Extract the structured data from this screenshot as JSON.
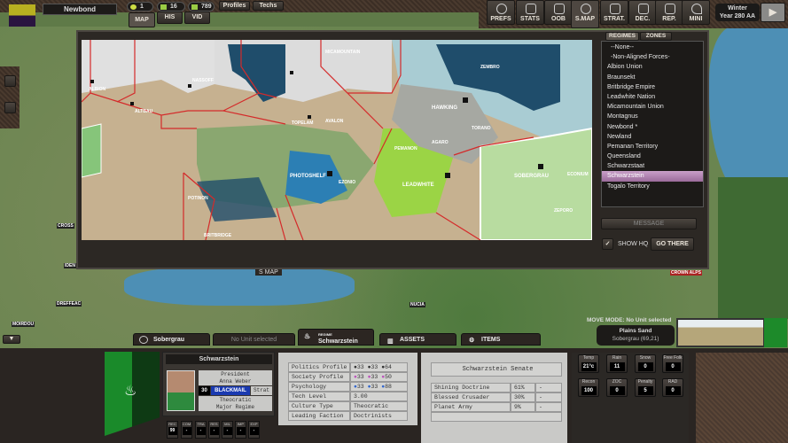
{
  "topbar": {
    "regime_name": "Newbond",
    "resources": [
      {
        "icon": "political-point-icon",
        "value": "1"
      },
      {
        "icon": "people-icon",
        "value": "16"
      },
      {
        "icon": "credits-icon",
        "value": "789"
      }
    ],
    "profiles_label": "Profiles",
    "techs_label": "Techs",
    "view_tabs": [
      "MAP",
      "HIS",
      "VID"
    ],
    "active_tab": "MAP"
  },
  "menu": {
    "buttons": [
      {
        "label": "PREFS",
        "icon": "gear-icon"
      },
      {
        "label": "STATS",
        "icon": "chart-icon"
      },
      {
        "label": "OOB",
        "icon": "hierarchy-icon"
      },
      {
        "label": "S.MAP",
        "icon": "globe-icon"
      },
      {
        "label": "STRAT.",
        "icon": "cards-icon"
      },
      {
        "label": "DEC.",
        "icon": "envelope-icon"
      },
      {
        "label": "REP.",
        "icon": "report-icon"
      },
      {
        "label": "MINI",
        "icon": "pin-icon"
      }
    ]
  },
  "turn": {
    "season": "Winter",
    "year": "Year 280 AA"
  },
  "strategic_map": {
    "label": "S MAP",
    "cities": [
      "ALBION",
      "ALTBAU",
      "NASSOFF",
      "MICAMOUNTAIN",
      "TOPELAM",
      "AVALON",
      "PHOTOSHELF",
      "EZONIO",
      "POTINON",
      "BRITBRIDGE",
      "PEMANON",
      "AGARO",
      "HAWKING",
      "TORANO",
      "ZEMBRO",
      "LEADWHITE",
      "SOBERGRAU",
      "ECONIUM",
      "ZEPORO"
    ],
    "colors": {
      "border": "#d42a2a",
      "water": "#1f4d6b",
      "highlight": "#9bd445"
    }
  },
  "regime_panel": {
    "tabs": [
      "REGIMES",
      "ZONES"
    ],
    "items": [
      "--None--",
      "-Non-Aligned Forces-",
      "Albion Union",
      "Braunsekt",
      "Britbridge Empire",
      "Leadwhite Nation",
      "Micamountain Union",
      "Montagnus",
      "Newbond *",
      "Newland",
      "Pemanan Territory",
      "Queensland",
      "Schwarzstaat",
      "Schwarzstein",
      "Togalo Territory"
    ],
    "selected": "Schwarzstein",
    "message_label": "MESSAGE",
    "show_hq_label": "SHOW HQ",
    "show_hq_checked": true,
    "go_there_label": "GO THERE"
  },
  "world_labels": [
    "CROSS",
    "IDEN",
    "DREFFEAC",
    "MOIRDOU",
    "NUCIA",
    "CROWN ALPS"
  ],
  "bottom_tabs": [
    {
      "label": "Sobergrau",
      "icon": "hex-icon"
    },
    {
      "label": "No Unit selected",
      "icon": ""
    },
    {
      "sub": "REGIME",
      "label": "Schwarzstein",
      "icon": "regime-icon"
    },
    {
      "label": "ASSETS",
      "icon": "building-icon"
    },
    {
      "label": "ITEMS",
      "icon": "gear-icon"
    }
  ],
  "location": {
    "move_mode": "MOVE MODE: No Unit selected",
    "terrain": "Plains Sand",
    "hex": "Sobergrau (69,21)"
  },
  "leader": {
    "regime": "Schwarzstein",
    "title": "President",
    "name": "Anna Weber",
    "level": "30",
    "trait": "BLACKMAIL",
    "strat_label": "Strat",
    "type_line1": "Theocratic",
    "type_line2": "Major Regime",
    "stats": [
      {
        "k": "REC",
        "v": "99"
      },
      {
        "k": "COM",
        "v": "-"
      },
      {
        "k": "TRA",
        "v": "-"
      },
      {
        "k": "RES",
        "v": "-"
      },
      {
        "k": "MIL",
        "v": "-"
      },
      {
        "k": "IMP",
        "v": "-"
      },
      {
        "k": "EXP",
        "v": "-"
      }
    ]
  },
  "profile": {
    "rows": [
      {
        "label": "Politics Profile",
        "vals": [
          "33",
          "33",
          "64"
        ]
      },
      {
        "label": "Society Profile",
        "vals": [
          "33",
          "33",
          "50"
        ]
      },
      {
        "label": "Psychology Profile",
        "vals": [
          "33",
          "33",
          "88"
        ]
      }
    ],
    "tech_label": "Tech Level",
    "tech": "3.00",
    "culture_label": "Culture Type",
    "culture": "Theocratic",
    "faction_label": "Leading Faction",
    "faction": "Doctrinists"
  },
  "senate": {
    "title": "Schwarzstein Senate",
    "rows": [
      {
        "name": "Shining Doctrine School",
        "pct": "61%",
        "x": "-"
      },
      {
        "name": "Blessed Crusader Knights",
        "pct": "30%",
        "x": "-"
      },
      {
        "name": "Planet Army",
        "pct": "9%",
        "x": "-"
      }
    ]
  },
  "hex_stats": [
    {
      "k": "Temp",
      "v": "21°c"
    },
    {
      "k": "Rain",
      "v": "11"
    },
    {
      "k": "Snow",
      "v": "0"
    },
    {
      "k": "Free Folk",
      "v": "0"
    },
    {
      "k": "Recon",
      "v": "100"
    },
    {
      "k": "ZOC",
      "v": "0"
    },
    {
      "k": "Penalty",
      "v": "5"
    },
    {
      "k": "RAD",
      "v": "0"
    }
  ]
}
